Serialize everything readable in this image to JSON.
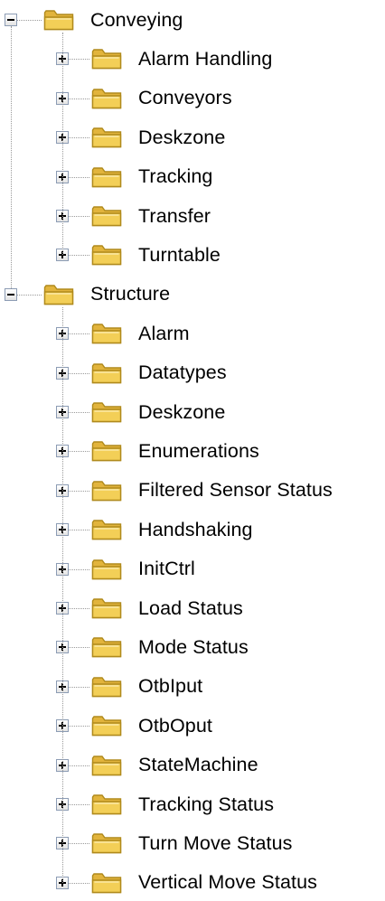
{
  "tree": [
    {
      "label": "Conveying",
      "state": "expanded",
      "children": [
        {
          "label": "Alarm Handling"
        },
        {
          "label": "Conveyors"
        },
        {
          "label": "Deskzone"
        },
        {
          "label": "Tracking"
        },
        {
          "label": "Transfer"
        },
        {
          "label": "Turntable"
        }
      ]
    },
    {
      "label": "Structure",
      "state": "expanded",
      "children": [
        {
          "label": "Alarm"
        },
        {
          "label": "Datatypes"
        },
        {
          "label": "Deskzone"
        },
        {
          "label": "Enumerations"
        },
        {
          "label": "Filtered Sensor Status"
        },
        {
          "label": "Handshaking"
        },
        {
          "label": "InitCtrl"
        },
        {
          "label": "Load Status"
        },
        {
          "label": "Mode Status"
        },
        {
          "label": "OtbIput"
        },
        {
          "label": "OtbOput"
        },
        {
          "label": "StateMachine"
        },
        {
          "label": "Tracking Status"
        },
        {
          "label": "Turn Move Status"
        },
        {
          "label": "Vertical Move Status"
        }
      ]
    }
  ],
  "colors": {
    "folder_fill": "#f3cf57",
    "folder_edge": "#b08a1c",
    "connector": "#9a9a9a"
  },
  "icons": {
    "folder": "folder-icon",
    "expand": "plus-icon",
    "collapse": "minus-icon"
  }
}
